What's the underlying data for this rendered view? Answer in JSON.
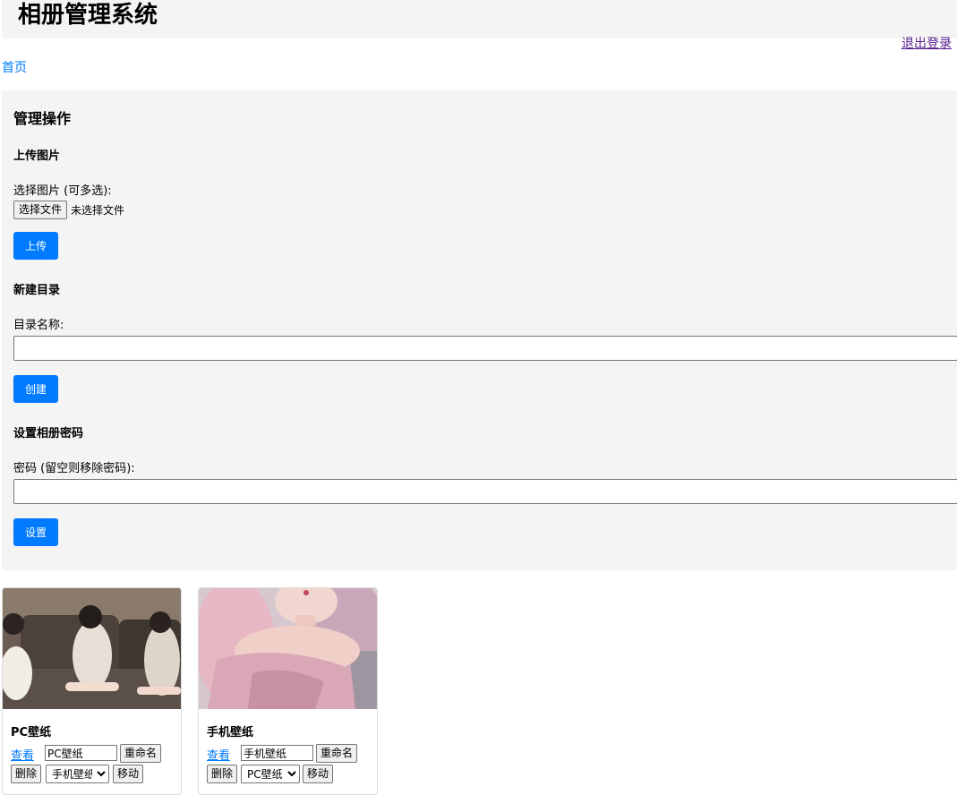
{
  "header": {
    "title": "相册管理系统",
    "logout_label": "退出登录"
  },
  "breadcrumb": {
    "home_label": "首页"
  },
  "admin": {
    "title": "管理操作",
    "upload": {
      "title": "上传图片",
      "label": "选择图片 (可多选):",
      "file_button": "选择文件",
      "file_status": "未选择文件",
      "submit_label": "上传"
    },
    "new_folder": {
      "title": "新建目录",
      "label": "目录名称:",
      "value": "",
      "submit_label": "创建"
    },
    "password": {
      "title": "设置相册密码",
      "label": "密码 (留空则移除密码):",
      "value": "",
      "submit_label": "设置"
    }
  },
  "albums": [
    {
      "name": "PC壁纸",
      "view_label": "查看",
      "rename_value": "PC壁纸",
      "rename_label": "重命名",
      "delete_label": "删除",
      "move_target": "手机壁纸",
      "move_label": "移动"
    },
    {
      "name": "手机壁纸",
      "view_label": "查看",
      "rename_value": "手机壁纸",
      "rename_label": "重命名",
      "delete_label": "删除",
      "move_target": "PC壁纸",
      "move_label": "移动"
    }
  ],
  "colors": {
    "accent": "#007bff",
    "panel_bg": "#f4f4f4",
    "visited_link": "#551a8b"
  }
}
